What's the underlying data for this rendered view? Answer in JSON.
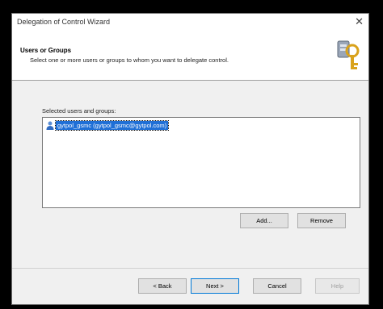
{
  "window": {
    "title": "Delegation of Control Wizard",
    "close_glyph": "✕"
  },
  "header": {
    "title": "Users or Groups",
    "subtitle": "Select one or more users or groups to whom you want to delegate control."
  },
  "list": {
    "label": "Selected users and groups:",
    "items": [
      {
        "text": "gytpol_gsmc (gytpol_gsmc@gytpol.com)",
        "icon": "user-icon",
        "selected": true
      }
    ]
  },
  "buttons": {
    "add": "Add...",
    "remove": "Remove",
    "back": "< Back",
    "next": "Next >",
    "cancel": "Cancel",
    "help": "Help"
  },
  "colors": {
    "selection": "#1f6fd6",
    "accent_border": "#0078d7"
  }
}
